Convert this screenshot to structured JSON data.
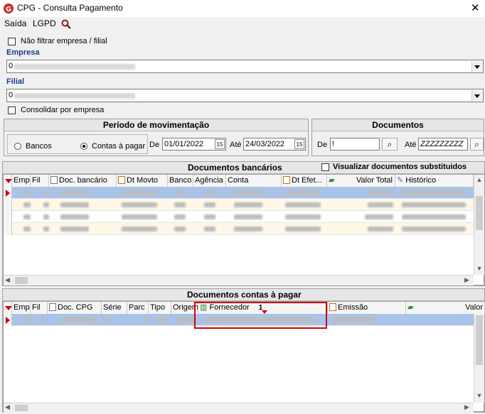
{
  "window": {
    "title": "CPG - Consulta Pagamento",
    "close": "✕"
  },
  "menu": {
    "items": [
      "Saída",
      "LGPD"
    ]
  },
  "filters": {
    "nao_filtrar_label": "Não filtrar empresa / filial",
    "empresa_label": "Empresa",
    "empresa_value": "0",
    "filial_label": "Filial",
    "filial_value": "0",
    "consolidar_label": "Consolidar por empresa"
  },
  "periodo": {
    "title": "Período de movimentação",
    "bancos_label": "Bancos",
    "contas_label": "Contas à pagar",
    "selected": "contas",
    "de_label": "De",
    "de_value": "01/01/2022",
    "ate_label": "Até",
    "ate_value": "24/03/2022"
  },
  "documentos": {
    "title": "Documentos",
    "de_label": "De",
    "de_value": "!",
    "ate_label": "Até",
    "ate_value": "ZZZZZZZZZ"
  },
  "bancarios": {
    "title": "Documentos bancários",
    "visualizar_label": "Visualizar documentos substituidos",
    "columns": [
      "Emp",
      "Fil",
      "Doc. bancário",
      "Dt Movto",
      "Banco",
      "Agência",
      "Conta",
      "Dt Efet...",
      "Valor Total",
      "Histórico"
    ],
    "row_count": 4
  },
  "contas": {
    "title": "Documentos contas à pagar",
    "columns": [
      "Emp",
      "Fil",
      "Doc. CPG",
      "Série",
      "Parc",
      "Tipo",
      "Origem",
      "Fornecedor",
      "Emissão",
      "Valor"
    ],
    "sort_indicator": "1",
    "row_count": 1
  },
  "colors": {
    "selected_row": "#a9c4ea",
    "alt_row": "#fff7e8",
    "highlight": "#d00000",
    "brand": "#c62828"
  }
}
